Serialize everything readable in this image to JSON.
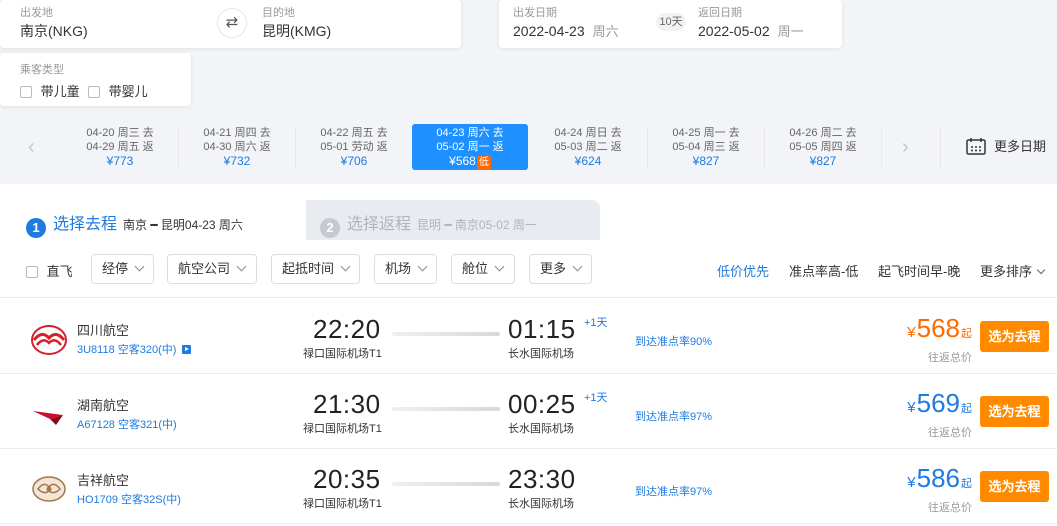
{
  "search": {
    "from_label": "出发地",
    "from_value": "南京(NKG)",
    "swap_icon": "swap-arrows-icon",
    "to_label": "目的地",
    "to_value": "昆明(KMG)",
    "depart_label": "出发日期",
    "depart_date": "2022-04-23",
    "depart_week": "周六",
    "days_badge": "10天",
    "return_label": "返回日期",
    "return_date": "2022-05-02",
    "return_week": "周一"
  },
  "passenger": {
    "label": "乘客类型",
    "child": "带儿童",
    "infant": "带婴儿"
  },
  "date_strip": {
    "prev_icon": "chevron-left-icon",
    "next_icon": "chevron-right-icon",
    "more_dates": "更多日期",
    "cells": [
      {
        "line1": "04-20  周三 去",
        "line2": "04-29  周五 返",
        "price": "¥773",
        "low": ""
      },
      {
        "line1": "04-21  周四 去",
        "line2": "04-30  周六 返",
        "price": "¥732",
        "low": ""
      },
      {
        "line1": "04-22  周五 去",
        "line2": "05-01  劳动 返",
        "price": "¥706",
        "low": ""
      },
      {
        "line1": "04-23  周六 去",
        "line2": "05-02  周一 返",
        "price": "¥568",
        "low": "低"
      },
      {
        "line1": "04-24  周日 去",
        "line2": "05-03  周二 返",
        "price": "¥624",
        "low": ""
      },
      {
        "line1": "04-25  周一 去",
        "line2": "05-04  周三 返",
        "price": "¥827",
        "low": ""
      },
      {
        "line1": "04-26  周二 去",
        "line2": "05-05  周四 返",
        "price": "¥827",
        "low": ""
      }
    ]
  },
  "steps": [
    {
      "num": "1",
      "title": "选择去程",
      "route": "南京 ━ 昆明04-23 周六"
    },
    {
      "num": "2",
      "title": "选择返程",
      "route": "昆明 ━ 南京05-02 周一"
    }
  ],
  "filters": {
    "direct": "直飞",
    "buttons": [
      "经停",
      "航空公司",
      "起抵时间",
      "机场",
      "舱位",
      "更多"
    ],
    "sorts": [
      "低价优先",
      "准点率高-低",
      "起飞时间早-晚",
      "更多排序"
    ]
  },
  "flights": [
    {
      "airline": "四川航空",
      "flight": "3U8118 空客320(中)",
      "dep_time": "22:20",
      "dep_airport": "禄口国际机场T1",
      "arr_time": "01:15",
      "arr_airport": "长水国际机场",
      "plus_day": "+1天",
      "ontime": "到达准点率90%",
      "price": "568",
      "price_color": "#ff6a00",
      "price_note": "往返总价",
      "select": "选为去程",
      "logo": "sichuan-airlines-logo"
    },
    {
      "airline": "湖南航空",
      "flight": "A67128 空客321(中)",
      "dep_time": "21:30",
      "dep_airport": "禄口国际机场T1",
      "arr_time": "00:25",
      "arr_airport": "长水国际机场",
      "plus_day": "+1天",
      "ontime": "到达准点率97%",
      "price": "569",
      "price_color": "#1e7be0",
      "price_note": "往返总价",
      "select": "选为去程",
      "logo": "hunan-airlines-logo"
    },
    {
      "airline": "吉祥航空",
      "flight": "HO1709 空客32S(中)",
      "dep_time": "20:35",
      "dep_airport": "禄口国际机场T1",
      "arr_time": "23:30",
      "arr_airport": "长水国际机场",
      "plus_day": "",
      "ontime": "到达准点率97%",
      "price": "586",
      "price_color": "#1e7be0",
      "price_note": "往返总价",
      "select": "选为去程",
      "logo": "juneyao-airlines-logo"
    }
  ],
  "colors": {
    "accent": "#1e7be0",
    "active_date": "#1e90ff",
    "orange": "#ff8a00"
  }
}
